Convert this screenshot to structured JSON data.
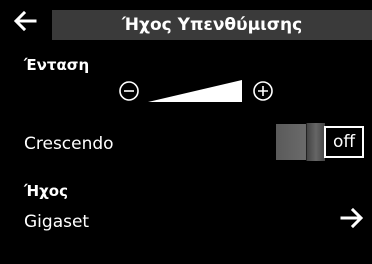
{
  "header": {
    "title": "Ήχος Υπενθύμισης",
    "back_icon": "back-arrow-icon"
  },
  "volume": {
    "label": "Ένταση",
    "decrease_icon": "minus-circle-icon",
    "increase_icon": "plus-circle-icon",
    "level": 1.0
  },
  "crescendo": {
    "label": "Crescendo",
    "state": "off"
  },
  "sound": {
    "label": "Ήχος",
    "value": "Gigaset",
    "forward_icon": "forward-arrow-icon"
  },
  "colors": {
    "background": "#000000",
    "title_bar": "#3a3a3a",
    "text": "#ffffff"
  }
}
